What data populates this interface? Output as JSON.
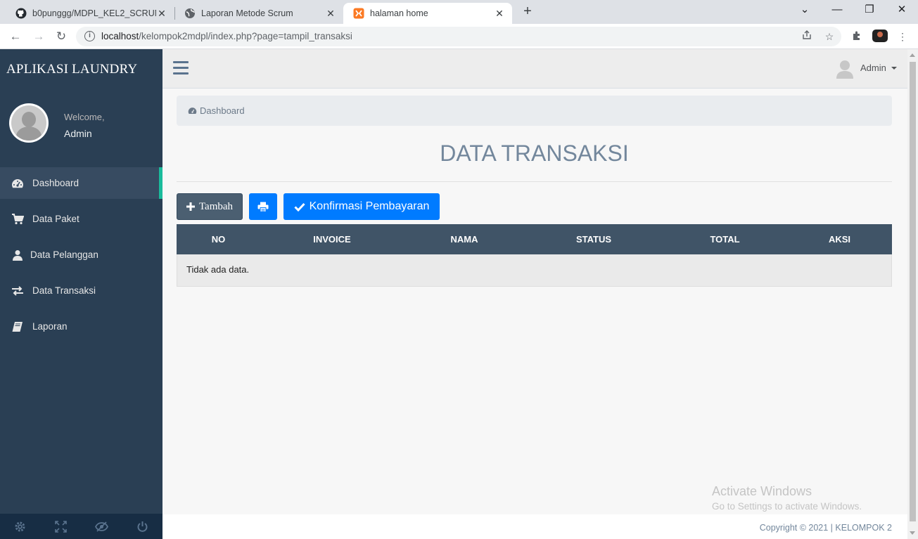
{
  "browser": {
    "tabs": [
      {
        "title": "b0punggg/MDPL_KEL2_SCRUM",
        "icon": "github-icon"
      },
      {
        "title": "Laporan Metode Scrum",
        "icon": "globe-icon"
      },
      {
        "title": "halaman home",
        "icon": "xampp-icon",
        "active": true
      }
    ],
    "url_host": "localhost",
    "url_path": "/kelompok2mdpl/index.php?page=tampil_transaksi"
  },
  "sidebar": {
    "brand": "APLIKASI LAUNDRY",
    "welcome": "Welcome,",
    "username": "Admin",
    "menu": [
      {
        "label": "Dashboard",
        "icon": "dashboard-icon",
        "active": true
      },
      {
        "label": "Data Paket",
        "icon": "cart-icon"
      },
      {
        "label": "Data Pelanggan",
        "icon": "user-icon"
      },
      {
        "label": "Data Transaksi",
        "icon": "exchange-icon"
      },
      {
        "label": "Laporan",
        "icon": "book-icon"
      }
    ],
    "footer_icons": [
      "settings-icon",
      "fullscreen-icon",
      "hide-icon",
      "power-icon"
    ]
  },
  "topnav": {
    "user": "Admin"
  },
  "breadcrumb": "Dashboard",
  "page_title": "DATA TRANSAKSI",
  "buttons": {
    "tambah": "Tambah",
    "konfirmasi": "Konfirmasi Pembayaran"
  },
  "table": {
    "headers": [
      "NO",
      "INVOICE",
      "NAMA",
      "STATUS",
      "TOTAL",
      "AKSI"
    ],
    "empty_text": "Tidak ada data."
  },
  "footer": {
    "copyright": "Copyright © 2021 | KELOMPOK 2"
  },
  "watermark": {
    "line1": "Activate Windows",
    "line2": "Go to Settings to activate Windows."
  },
  "colors": {
    "sidebar": "#2a3f54",
    "accent": "#1abb9c",
    "primary": "#007bff",
    "table_header": "#405467"
  }
}
